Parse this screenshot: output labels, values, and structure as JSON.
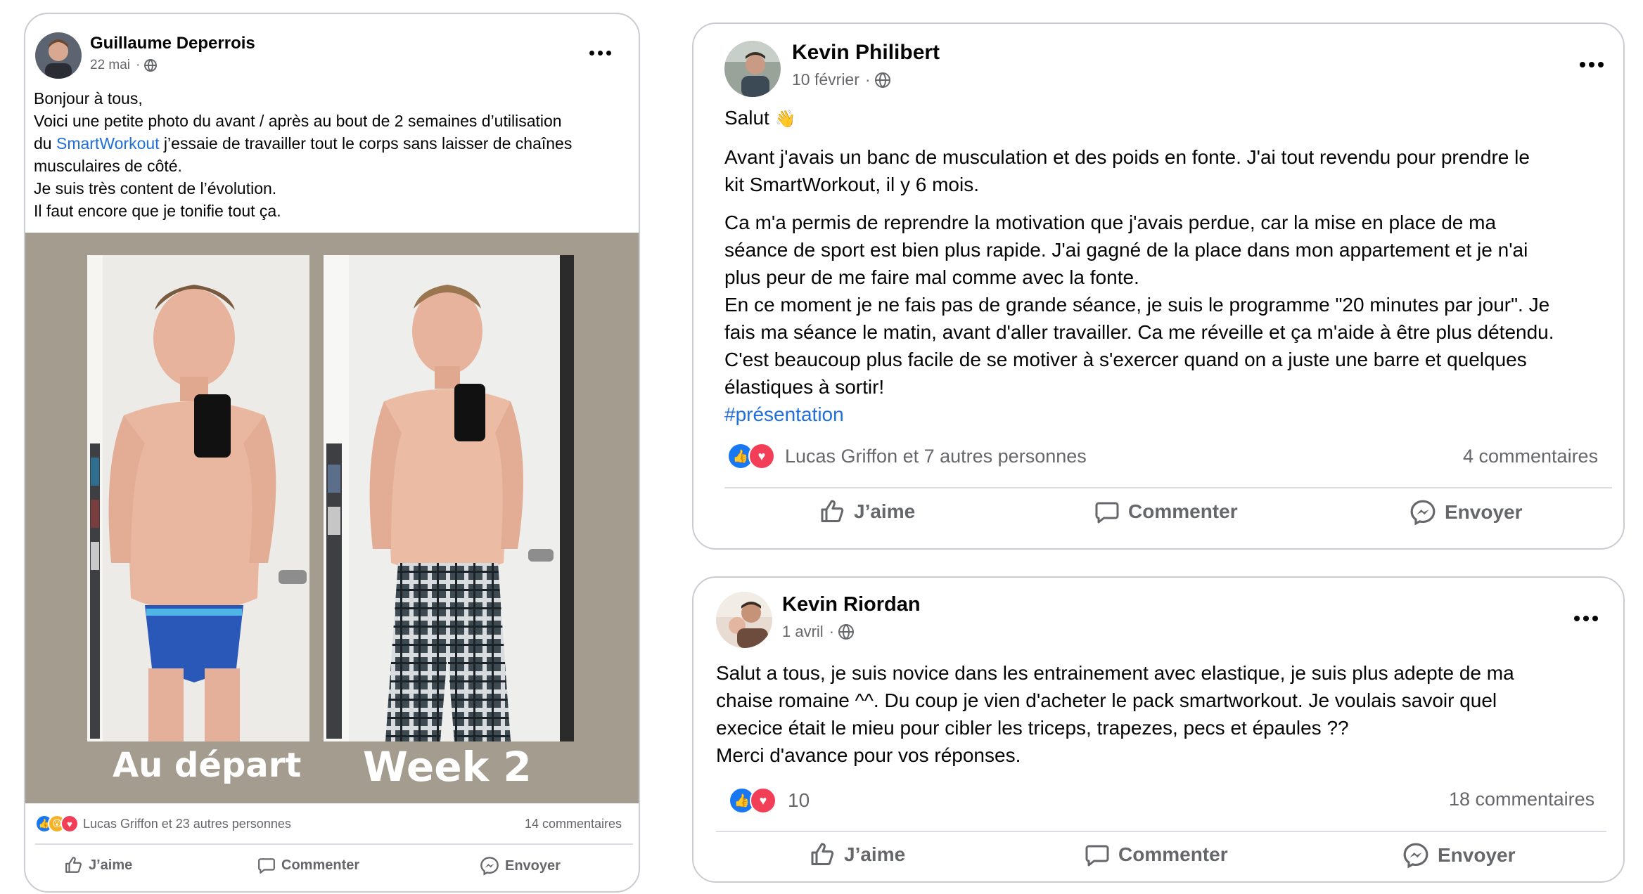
{
  "post1": {
    "author": "Guillaume Deperrois",
    "date": "22 mai",
    "separator": "·",
    "text_lines": [
      "Bonjour à tous,",
      "Voici une petite photo du avant / après au bout de 2 semaines d’utilisation"
    ],
    "line3_prefix": "du ",
    "line3_link": "SmartWorkout",
    "line3_suffix": " j’essaie de travailler tout le corps sans laisser de chaînes",
    "text_lines_2": [
      "musculaires de côté.",
      "Je suis très content de l’évolution.",
      "Il faut encore que je tonifie tout ça."
    ],
    "photo_label_left": "Au départ",
    "photo_label_right": "Week 2",
    "reactions_text": "Lucas Griffon et 23 autres personnes",
    "comments": "14 commentaires",
    "actions": {
      "like": "J’aime",
      "comment": "Commenter",
      "send": "Envoyer"
    }
  },
  "post2": {
    "author": "Kevin Philibert",
    "date": "10 février",
    "separator": "·",
    "greeting": "Salut",
    "greeting_emoji": "👋",
    "para1": [
      "Avant j'avais un banc de musculation et des poids en fonte. J'ai tout revendu pour prendre le",
      "kit SmartWorkout, il y 6 mois."
    ],
    "para2": [
      "Ca m'a permis de reprendre la motivation que j'avais perdue, car la mise en place de ma",
      "séance de sport est bien plus rapide. J'ai gagné de la place dans mon appartement et je n'ai",
      "plus peur de me faire mal comme avec la fonte.",
      "En ce moment je ne fais pas de grande séance, je suis le programme \"20 minutes par jour\". Je",
      "fais ma séance le matin, avant d'aller travailler. Ca me réveille et ça m'aide à être plus détendu.",
      "C'est beaucoup plus facile de se motiver à s'exercer quand on a juste une barre et quelques",
      "élastiques à sortir!"
    ],
    "hashtag": "#présentation",
    "reactions_text": "Lucas Griffon et 7 autres personnes",
    "comments": "4 commentaires",
    "actions": {
      "like": "J’aime",
      "comment": "Commenter",
      "send": "Envoyer"
    }
  },
  "post3": {
    "author": "Kevin Riordan",
    "date": "1 avril",
    "separator": "·",
    "text_lines": [
      "Salut a tous, je suis novice dans les entrainement avec elastique, je suis plus adepte de ma",
      "chaise romaine ^^. Du coup je vien d'acheter le pack smartworkout. Je voulais savoir quel",
      "execice était le mieu pour cibler les triceps, trapezes, pecs et épaules ??",
      "Merci d'avance pour vos réponses."
    ],
    "reactions_count": "10",
    "comments": "18 commentaires",
    "actions": {
      "like": "J’aime",
      "comment": "Commenter",
      "send": "Envoyer"
    }
  },
  "icons": {
    "more": "more-horizontal-icon",
    "audience": "globe-icon",
    "like": "thumbs-up-icon",
    "comment": "comment-bubble-icon",
    "send": "messenger-icon",
    "reaction_like": "like-reaction-icon",
    "reaction_love": "love-reaction-icon",
    "reaction_wow": "wow-reaction-icon"
  },
  "colors": {
    "link": "#216fdb",
    "like": "#1877f2",
    "love": "#f33e58",
    "wow": "#f7b125",
    "secondary_text": "#65676b"
  }
}
